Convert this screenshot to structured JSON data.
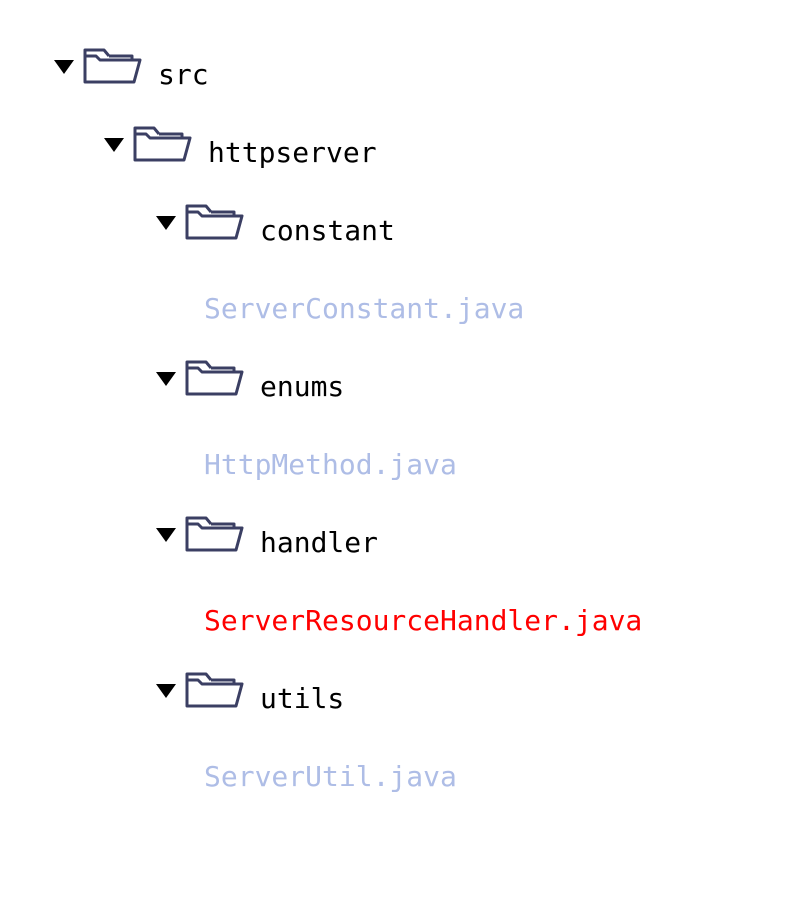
{
  "tree": {
    "src": "src",
    "httpserver": "httpserver",
    "constant": "constant",
    "serverConstant": "ServerConstant.java",
    "enums": "enums",
    "httpMethod": "HttpMethod.java",
    "handler": "handler",
    "serverResourceHandler": "ServerResourceHandler.java",
    "utils": "utils",
    "serverUtil": "ServerUtil.java"
  },
  "colors": {
    "folderStroke": "#3b3f63",
    "fileBlue": "#aebde6",
    "fileRed": "#ff0000",
    "text": "#000000"
  }
}
